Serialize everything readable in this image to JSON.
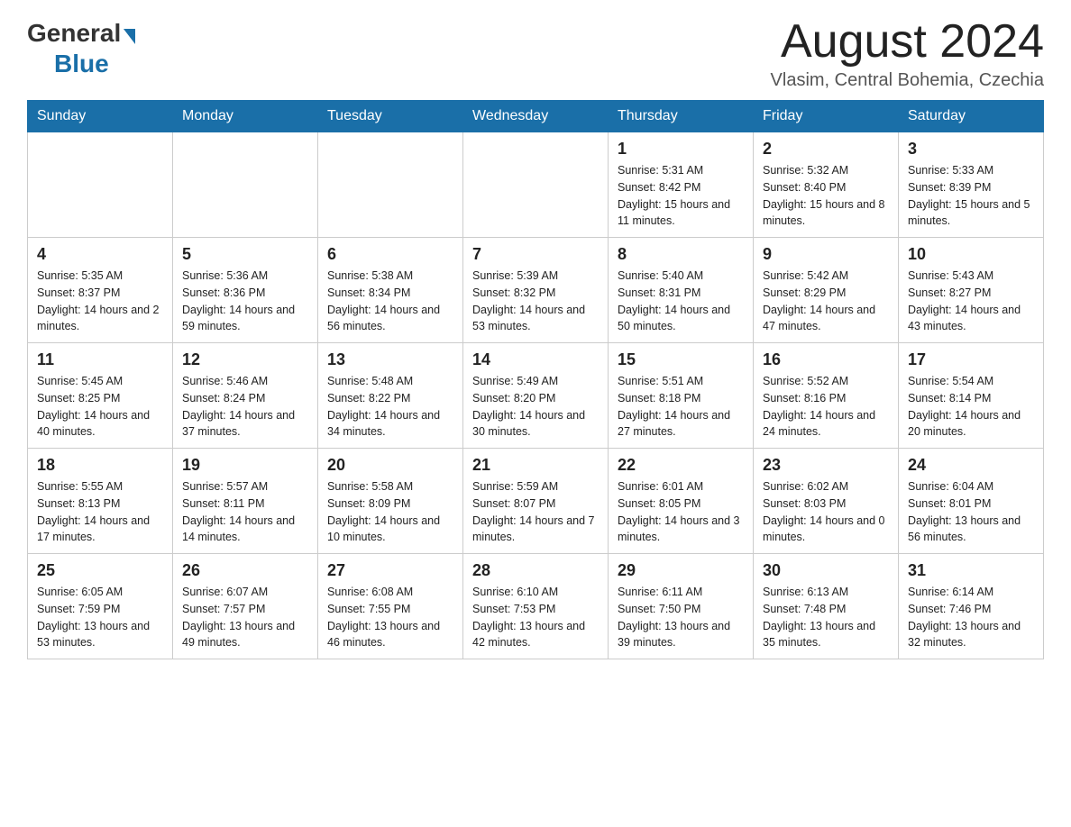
{
  "logo": {
    "general": "General",
    "blue": "Blue",
    "triangle": "▲"
  },
  "header": {
    "month_year": "August 2024",
    "location": "Vlasim, Central Bohemia, Czechia"
  },
  "weekdays": [
    "Sunday",
    "Monday",
    "Tuesday",
    "Wednesday",
    "Thursday",
    "Friday",
    "Saturday"
  ],
  "weeks": [
    [
      {
        "day": "",
        "info": ""
      },
      {
        "day": "",
        "info": ""
      },
      {
        "day": "",
        "info": ""
      },
      {
        "day": "",
        "info": ""
      },
      {
        "day": "1",
        "info": "Sunrise: 5:31 AM\nSunset: 8:42 PM\nDaylight: 15 hours and 11 minutes."
      },
      {
        "day": "2",
        "info": "Sunrise: 5:32 AM\nSunset: 8:40 PM\nDaylight: 15 hours and 8 minutes."
      },
      {
        "day": "3",
        "info": "Sunrise: 5:33 AM\nSunset: 8:39 PM\nDaylight: 15 hours and 5 minutes."
      }
    ],
    [
      {
        "day": "4",
        "info": "Sunrise: 5:35 AM\nSunset: 8:37 PM\nDaylight: 14 hours and 2 minutes."
      },
      {
        "day": "5",
        "info": "Sunrise: 5:36 AM\nSunset: 8:36 PM\nDaylight: 14 hours and 59 minutes."
      },
      {
        "day": "6",
        "info": "Sunrise: 5:38 AM\nSunset: 8:34 PM\nDaylight: 14 hours and 56 minutes."
      },
      {
        "day": "7",
        "info": "Sunrise: 5:39 AM\nSunset: 8:32 PM\nDaylight: 14 hours and 53 minutes."
      },
      {
        "day": "8",
        "info": "Sunrise: 5:40 AM\nSunset: 8:31 PM\nDaylight: 14 hours and 50 minutes."
      },
      {
        "day": "9",
        "info": "Sunrise: 5:42 AM\nSunset: 8:29 PM\nDaylight: 14 hours and 47 minutes."
      },
      {
        "day": "10",
        "info": "Sunrise: 5:43 AM\nSunset: 8:27 PM\nDaylight: 14 hours and 43 minutes."
      }
    ],
    [
      {
        "day": "11",
        "info": "Sunrise: 5:45 AM\nSunset: 8:25 PM\nDaylight: 14 hours and 40 minutes."
      },
      {
        "day": "12",
        "info": "Sunrise: 5:46 AM\nSunset: 8:24 PM\nDaylight: 14 hours and 37 minutes."
      },
      {
        "day": "13",
        "info": "Sunrise: 5:48 AM\nSunset: 8:22 PM\nDaylight: 14 hours and 34 minutes."
      },
      {
        "day": "14",
        "info": "Sunrise: 5:49 AM\nSunset: 8:20 PM\nDaylight: 14 hours and 30 minutes."
      },
      {
        "day": "15",
        "info": "Sunrise: 5:51 AM\nSunset: 8:18 PM\nDaylight: 14 hours and 27 minutes."
      },
      {
        "day": "16",
        "info": "Sunrise: 5:52 AM\nSunset: 8:16 PM\nDaylight: 14 hours and 24 minutes."
      },
      {
        "day": "17",
        "info": "Sunrise: 5:54 AM\nSunset: 8:14 PM\nDaylight: 14 hours and 20 minutes."
      }
    ],
    [
      {
        "day": "18",
        "info": "Sunrise: 5:55 AM\nSunset: 8:13 PM\nDaylight: 14 hours and 17 minutes."
      },
      {
        "day": "19",
        "info": "Sunrise: 5:57 AM\nSunset: 8:11 PM\nDaylight: 14 hours and 14 minutes."
      },
      {
        "day": "20",
        "info": "Sunrise: 5:58 AM\nSunset: 8:09 PM\nDaylight: 14 hours and 10 minutes."
      },
      {
        "day": "21",
        "info": "Sunrise: 5:59 AM\nSunset: 8:07 PM\nDaylight: 14 hours and 7 minutes."
      },
      {
        "day": "22",
        "info": "Sunrise: 6:01 AM\nSunset: 8:05 PM\nDaylight: 14 hours and 3 minutes."
      },
      {
        "day": "23",
        "info": "Sunrise: 6:02 AM\nSunset: 8:03 PM\nDaylight: 14 hours and 0 minutes."
      },
      {
        "day": "24",
        "info": "Sunrise: 6:04 AM\nSunset: 8:01 PM\nDaylight: 13 hours and 56 minutes."
      }
    ],
    [
      {
        "day": "25",
        "info": "Sunrise: 6:05 AM\nSunset: 7:59 PM\nDaylight: 13 hours and 53 minutes."
      },
      {
        "day": "26",
        "info": "Sunrise: 6:07 AM\nSunset: 7:57 PM\nDaylight: 13 hours and 49 minutes."
      },
      {
        "day": "27",
        "info": "Sunrise: 6:08 AM\nSunset: 7:55 PM\nDaylight: 13 hours and 46 minutes."
      },
      {
        "day": "28",
        "info": "Sunrise: 6:10 AM\nSunset: 7:53 PM\nDaylight: 13 hours and 42 minutes."
      },
      {
        "day": "29",
        "info": "Sunrise: 6:11 AM\nSunset: 7:50 PM\nDaylight: 13 hours and 39 minutes."
      },
      {
        "day": "30",
        "info": "Sunrise: 6:13 AM\nSunset: 7:48 PM\nDaylight: 13 hours and 35 minutes."
      },
      {
        "day": "31",
        "info": "Sunrise: 6:14 AM\nSunset: 7:46 PM\nDaylight: 13 hours and 32 minutes."
      }
    ]
  ]
}
